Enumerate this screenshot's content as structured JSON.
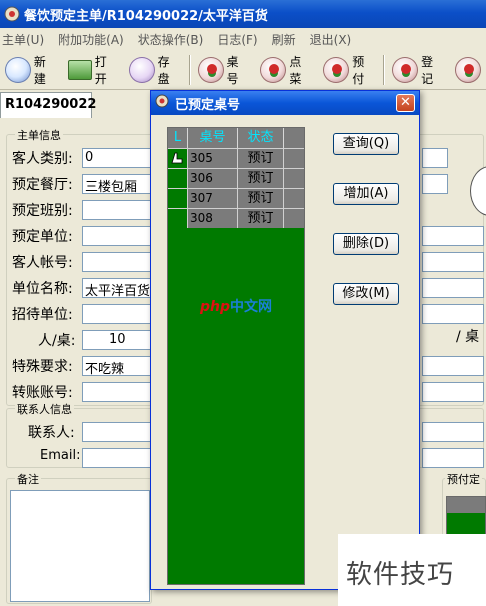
{
  "window": {
    "title": "餐饮预定主单/R104290022/太平洋百货"
  },
  "menu": [
    "主单(U)",
    "附加功能(A)",
    "状态操作(B)",
    "日志(F)",
    "刷新",
    "退出(X)"
  ],
  "toolbar": {
    "new": "新建",
    "open": "打开",
    "save": "存盘",
    "table": "桌号",
    "order": "点菜",
    "prepay": "预付",
    "register": "登记"
  },
  "tab": {
    "label": "R104290022"
  },
  "main_group": {
    "title": "主单信息",
    "guest_type_label": "客人类别:",
    "guest_type_value": "0",
    "hall_label": "预定餐厅:",
    "hall_value": "三楼包厢",
    "shift_label": "预定班别:",
    "unit_label": "预定单位:",
    "account_label": "客人帐号:",
    "company_label": "单位名称:",
    "company_value": "太平洋百货",
    "reception_label": "招待单位:",
    "per_table_label": "人/桌:",
    "per_table_value": "10",
    "per_table_unit": "/ 桌",
    "special_label": "特殊要求:",
    "special_value": "不吃辣",
    "transfer_label": "转账账号:"
  },
  "contact_group": {
    "title": "联系人信息",
    "contact_label": "联系人:",
    "email_label": "Email:"
  },
  "remarks_group": {
    "title": "备注"
  },
  "prepay_group": {
    "title": "预付定"
  },
  "dialog": {
    "title": "已预定桌号",
    "grid_headers": [
      "L",
      "桌号",
      "状态"
    ],
    "rows": [
      {
        "table": "305",
        "status": "预订"
      },
      {
        "table": "306",
        "status": "预订"
      },
      {
        "table": "307",
        "status": "预订"
      },
      {
        "table": "308",
        "status": "预订"
      }
    ],
    "btn_query": "查询(Q)",
    "btn_add": "增加(A)",
    "btn_delete": "删除(D)",
    "btn_edit": "修改(M)"
  },
  "watermark": {
    "brand_1": "php",
    "brand_2": "中文网"
  },
  "corner": {
    "text": "软件技巧"
  }
}
